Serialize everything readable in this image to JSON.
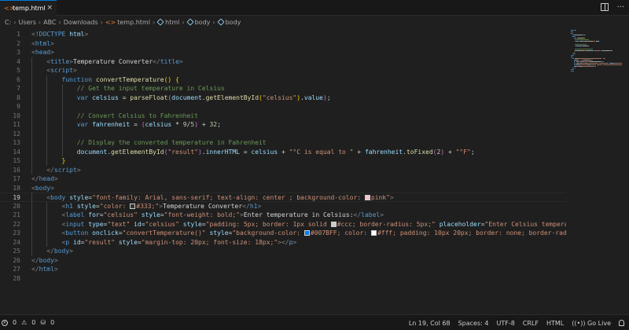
{
  "tab": {
    "filename": "temp.html",
    "close": "×"
  },
  "breadcrumb": [
    "C:",
    "Users",
    "ABC",
    "Downloads",
    "temp.html",
    "html",
    "body",
    "body"
  ],
  "editor": {
    "active_line": 19,
    "lines": [
      [
        [
          "t-punc",
          "<"
        ],
        [
          "t-tag",
          "!DOCTYPE"
        ],
        [
          "t-txt",
          " "
        ],
        [
          "t-attr",
          "html"
        ],
        [
          "t-punc",
          ">"
        ]
      ],
      [
        [
          "t-punc",
          "<"
        ],
        [
          "t-tag",
          "html"
        ],
        [
          "t-punc",
          ">"
        ]
      ],
      [
        [
          "t-punc",
          "<"
        ],
        [
          "t-tag",
          "head"
        ],
        [
          "t-punc",
          ">"
        ]
      ],
      [
        [
          "t-txt",
          "    "
        ],
        [
          "t-punc",
          "<"
        ],
        [
          "t-tag",
          "title"
        ],
        [
          "t-punc",
          ">"
        ],
        [
          "t-txt",
          "Temperature Converter"
        ],
        [
          "t-punc",
          "</"
        ],
        [
          "t-tag",
          "title"
        ],
        [
          "t-punc",
          ">"
        ]
      ],
      [
        [
          "t-txt",
          "    "
        ],
        [
          "t-punc",
          "<"
        ],
        [
          "t-tag",
          "script"
        ],
        [
          "t-punc",
          ">"
        ]
      ],
      [
        [
          "t-txt",
          "        "
        ],
        [
          "t-kw",
          "function"
        ],
        [
          "t-txt",
          " "
        ],
        [
          "t-fn",
          "convertTemperature"
        ],
        [
          "t-brk",
          "()"
        ],
        [
          "t-txt",
          " "
        ],
        [
          "t-brk",
          "{"
        ]
      ],
      [
        [
          "t-txt",
          "            "
        ],
        [
          "t-cmt",
          "// Get the input temperature in Celsius"
        ]
      ],
      [
        [
          "t-txt",
          "            "
        ],
        [
          "t-kw",
          "var"
        ],
        [
          "t-txt",
          " "
        ],
        [
          "t-var",
          "celsius"
        ],
        [
          "t-txt",
          " = "
        ],
        [
          "t-fn",
          "parseFloat"
        ],
        [
          "t-brk2",
          "("
        ],
        [
          "t-var",
          "document"
        ],
        [
          "t-txt",
          "."
        ],
        [
          "t-fn",
          "getElementById"
        ],
        [
          "t-brk",
          "("
        ],
        [
          "t-str",
          "\"celsius\""
        ],
        [
          "t-brk",
          ")"
        ],
        [
          "t-txt",
          "."
        ],
        [
          "t-var",
          "value"
        ],
        [
          "t-brk2",
          ")"
        ],
        [
          "t-txt",
          ";"
        ]
      ],
      [],
      [
        [
          "t-txt",
          "            "
        ],
        [
          "t-cmt",
          "// Convert Celsius to Fahrenheit"
        ]
      ],
      [
        [
          "t-txt",
          "            "
        ],
        [
          "t-kw",
          "var"
        ],
        [
          "t-txt",
          " "
        ],
        [
          "t-var",
          "fahrenheit"
        ],
        [
          "t-txt",
          " = "
        ],
        [
          "t-brk2",
          "("
        ],
        [
          "t-var",
          "celsius"
        ],
        [
          "t-txt",
          " * "
        ],
        [
          "t-num",
          "9"
        ],
        [
          "t-txt",
          "/"
        ],
        [
          "t-num",
          "5"
        ],
        [
          "t-brk2",
          ")"
        ],
        [
          "t-txt",
          " + "
        ],
        [
          "t-num",
          "32"
        ],
        [
          "t-txt",
          ";"
        ]
      ],
      [],
      [
        [
          "t-txt",
          "            "
        ],
        [
          "t-cmt",
          "// Display the converted temperature in Fahrenheit"
        ]
      ],
      [
        [
          "t-txt",
          "            "
        ],
        [
          "t-var",
          "document"
        ],
        [
          "t-txt",
          "."
        ],
        [
          "t-fn",
          "getElementById"
        ],
        [
          "t-brk2",
          "("
        ],
        [
          "t-str",
          "\"result\""
        ],
        [
          "t-brk2",
          ")"
        ],
        [
          "t-txt",
          "."
        ],
        [
          "t-var",
          "innerHTML"
        ],
        [
          "t-txt",
          " = "
        ],
        [
          "t-var",
          "celsius"
        ],
        [
          "t-txt",
          " + "
        ],
        [
          "t-str",
          "\"°C is equal to \""
        ],
        [
          "t-txt",
          " + "
        ],
        [
          "t-var",
          "fahrenheit"
        ],
        [
          "t-txt",
          "."
        ],
        [
          "t-fn",
          "toFixed"
        ],
        [
          "t-brk2",
          "("
        ],
        [
          "t-num",
          "2"
        ],
        [
          "t-brk2",
          ")"
        ],
        [
          "t-txt",
          " + "
        ],
        [
          "t-str",
          "\"°F\""
        ],
        [
          "t-txt",
          ";"
        ]
      ],
      [
        [
          "t-txt",
          "        "
        ],
        [
          "t-brk",
          "}"
        ]
      ],
      [
        [
          "t-txt",
          "    "
        ],
        [
          "t-punc",
          "</"
        ],
        [
          "t-tag",
          "script"
        ],
        [
          "t-punc",
          ">"
        ]
      ],
      [
        [
          "t-punc",
          "</"
        ],
        [
          "t-tag",
          "head"
        ],
        [
          "t-punc",
          ">"
        ]
      ],
      [
        [
          "t-punc",
          "<"
        ],
        [
          "t-tag",
          "body"
        ],
        [
          "t-punc",
          ">"
        ]
      ],
      [
        [
          "t-txt",
          "    "
        ],
        [
          "t-punc",
          "<"
        ],
        [
          "t-tag",
          "body"
        ],
        [
          "t-txt",
          " "
        ],
        [
          "t-attr",
          "style"
        ],
        [
          "t-txt",
          "="
        ],
        [
          "t-str",
          "\"font-family: Arial, sans-serif; text-align: center ; background-color: "
        ],
        [
          "swatch",
          "#ffc0cb"
        ],
        [
          "t-str",
          "pink\""
        ],
        [
          "t-punc",
          ">"
        ]
      ],
      [
        [
          "t-txt",
          "        "
        ],
        [
          "t-punc",
          "<"
        ],
        [
          "t-tag",
          "h1"
        ],
        [
          "t-txt",
          " "
        ],
        [
          "t-attr",
          "style"
        ],
        [
          "t-txt",
          "="
        ],
        [
          "t-str",
          "\"color: "
        ],
        [
          "swatch",
          "#333333"
        ],
        [
          "t-str",
          "#333;\""
        ],
        [
          "t-punc",
          ">"
        ],
        [
          "t-txt",
          "Temperature Converter"
        ],
        [
          "t-punc",
          "</"
        ],
        [
          "t-tag",
          "h1"
        ],
        [
          "t-punc",
          ">"
        ]
      ],
      [
        [
          "t-txt",
          "        "
        ],
        [
          "t-punc",
          "<"
        ],
        [
          "t-tag",
          "label"
        ],
        [
          "t-txt",
          " "
        ],
        [
          "t-attr",
          "for"
        ],
        [
          "t-txt",
          "="
        ],
        [
          "t-str",
          "\"celsius\""
        ],
        [
          "t-txt",
          " "
        ],
        [
          "t-attr",
          "style"
        ],
        [
          "t-txt",
          "="
        ],
        [
          "t-str",
          "\"font-weight: bold;\""
        ],
        [
          "t-punc",
          ">"
        ],
        [
          "t-txt",
          "Enter temperature in Celsius:"
        ],
        [
          "t-punc",
          "</"
        ],
        [
          "t-tag",
          "label"
        ],
        [
          "t-punc",
          ">"
        ]
      ],
      [
        [
          "t-txt",
          "        "
        ],
        [
          "t-punc",
          "<"
        ],
        [
          "t-tag",
          "input"
        ],
        [
          "t-txt",
          " "
        ],
        [
          "t-attr",
          "type"
        ],
        [
          "t-txt",
          "="
        ],
        [
          "t-str",
          "\"text\""
        ],
        [
          "t-txt",
          " "
        ],
        [
          "t-attr",
          "id"
        ],
        [
          "t-txt",
          "="
        ],
        [
          "t-str",
          "\"celsius\""
        ],
        [
          "t-txt",
          " "
        ],
        [
          "t-attr",
          "style"
        ],
        [
          "t-txt",
          "="
        ],
        [
          "t-str",
          "\"padding: 5px; border: 1px solid "
        ],
        [
          "swatch",
          "#cccccc"
        ],
        [
          "t-str",
          "#ccc; border-radius: 5px;\""
        ],
        [
          "t-txt",
          " "
        ],
        [
          "t-attr",
          "placeholder"
        ],
        [
          "t-txt",
          "="
        ],
        [
          "t-str",
          "\"Enter Celsius temperatur"
        ]
      ],
      [
        [
          "t-txt",
          "        "
        ],
        [
          "t-punc",
          "<"
        ],
        [
          "t-tag",
          "button"
        ],
        [
          "t-txt",
          " "
        ],
        [
          "t-attr",
          "onclick"
        ],
        [
          "t-txt",
          "="
        ],
        [
          "t-str",
          "\"convertTemperature()\""
        ],
        [
          "t-txt",
          " "
        ],
        [
          "t-attr",
          "style"
        ],
        [
          "t-txt",
          "="
        ],
        [
          "t-str",
          "\"background-color: "
        ],
        [
          "swatch",
          "#007bff"
        ],
        [
          "t-str",
          "#007BFF; color: "
        ],
        [
          "swatch",
          "#ffffff"
        ],
        [
          "t-str",
          "#fff; padding: 10px 20px; border: none; border-radius"
        ]
      ],
      [
        [
          "t-txt",
          "        "
        ],
        [
          "t-punc",
          "<"
        ],
        [
          "t-tag",
          "p"
        ],
        [
          "t-txt",
          " "
        ],
        [
          "t-attr",
          "id"
        ],
        [
          "t-txt",
          "="
        ],
        [
          "t-str",
          "\"result\""
        ],
        [
          "t-txt",
          " "
        ],
        [
          "t-attr",
          "style"
        ],
        [
          "t-txt",
          "="
        ],
        [
          "t-str",
          "\"margin-top: 20px; font-size: 18px;\""
        ],
        [
          "t-punc",
          "></"
        ],
        [
          "t-tag",
          "p"
        ],
        [
          "t-punc",
          ">"
        ]
      ],
      [
        [
          "t-txt",
          "    "
        ],
        [
          "t-punc",
          "</"
        ],
        [
          "t-tag",
          "body"
        ],
        [
          "t-punc",
          ">"
        ]
      ],
      [
        [
          "t-punc",
          "</"
        ],
        [
          "t-tag",
          "body"
        ],
        [
          "t-punc",
          ">"
        ]
      ],
      [
        [
          "t-punc",
          "</"
        ],
        [
          "t-tag",
          "html"
        ],
        [
          "t-punc",
          ">"
        ]
      ],
      []
    ]
  },
  "status": {
    "errors": "0",
    "warnings": "0",
    "ports": "0",
    "position": "Ln 19, Col 68",
    "spaces": "Spaces: 4",
    "encoding": "UTF-8",
    "eol": "CRLF",
    "language": "HTML",
    "live": "Go Live"
  }
}
